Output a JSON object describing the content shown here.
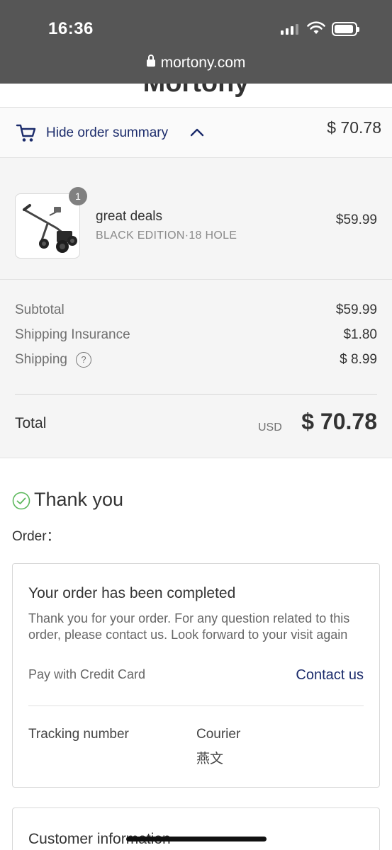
{
  "status_bar": {
    "time": "16:36",
    "url": "mortony.com"
  },
  "brand": "Mortony",
  "summary_toggle": {
    "label": "Hide order summary",
    "total": "$ 70.78",
    "icons": [
      "cart-icon",
      "chevron-up-icon"
    ]
  },
  "product": {
    "quantity": "1",
    "name": "great deals",
    "variant": "BLACK EDITION·18 HOLE",
    "price": "$59.99"
  },
  "costs": {
    "subtotal_label": "Subtotal",
    "subtotal_value": "$59.99",
    "insurance_label": "Shipping Insurance",
    "insurance_value": "$1.80",
    "shipping_label": "Shipping",
    "shipping_help": "?",
    "shipping_value": "$ 8.99",
    "total_label": "Total",
    "currency": "USD",
    "total_value": "$ 70.78"
  },
  "thank_you": {
    "title": "Thank you",
    "order_label": "Order："
  },
  "completion_card": {
    "heading": "Your order has been completed",
    "message": "Thank you for your order. For any question related to this order, please contact us. Look forward to your visit again",
    "payment": "Pay with Credit Card",
    "contact_link": "Contact us",
    "tracking_label": "Tracking number",
    "courier_label": "Courier",
    "courier_value": "燕文"
  },
  "customer_card": {
    "heading": "Customer information"
  },
  "colors": {
    "chrome": "#565656",
    "link": "#1b2b6b",
    "success": "#5cb85c"
  }
}
